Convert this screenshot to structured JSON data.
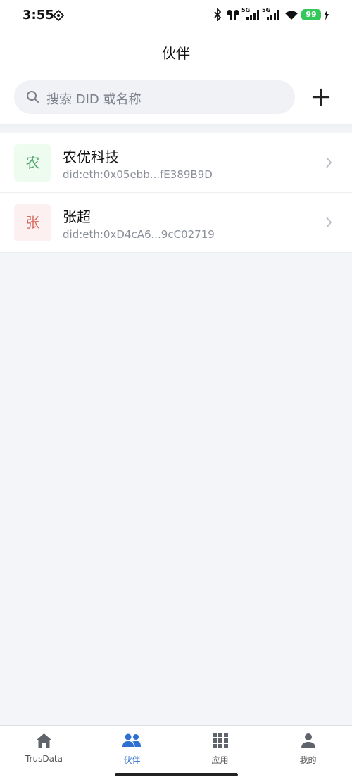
{
  "status_bar": {
    "time": "3:55",
    "battery": "99",
    "network_1": "5G",
    "network_2": "5G"
  },
  "header": {
    "title": "伙伴"
  },
  "search": {
    "placeholder": "搜索 DID 或名称"
  },
  "partners": [
    {
      "avatar_char": "农",
      "name": "农优科技",
      "did": "did:eth:0x05ebb...fE389B9D",
      "avatar_bg": "#eefbef",
      "avatar_color": "#4fa26a"
    },
    {
      "avatar_char": "张",
      "name": "张超",
      "did": "did:eth:0xD4cA6...9cC02719",
      "avatar_bg": "#fdf0f0",
      "avatar_color": "#d9695f"
    }
  ],
  "tabs": [
    {
      "label": "TrusData",
      "icon": "home-icon",
      "active": false
    },
    {
      "label": "伙伴",
      "icon": "partners-icon",
      "active": true
    },
    {
      "label": "应用",
      "icon": "apps-grid-icon",
      "active": false
    },
    {
      "label": "我的",
      "icon": "profile-icon",
      "active": false
    }
  ],
  "colors": {
    "accent": "#2f6fd2",
    "background": "#f4f5f9"
  }
}
